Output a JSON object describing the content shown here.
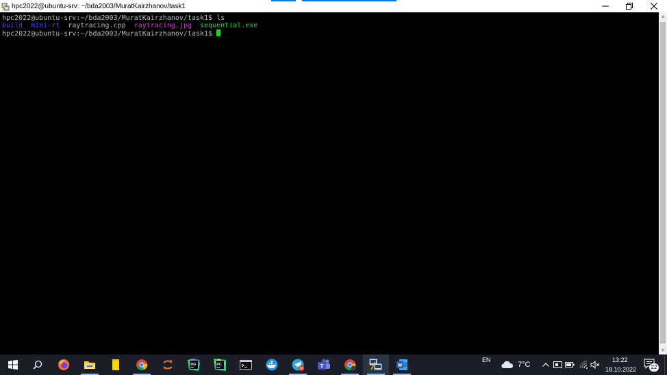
{
  "window": {
    "title": "hpc2022@ubuntu-srv: ~/bda2003/MuratKairzhanov/task1",
    "minimize_glyph": "—",
    "restore_glyph": "❐",
    "close_glyph": "✕"
  },
  "terminal": {
    "line1": {
      "prompt": "hpc2022@ubuntu-srv:~/bda2003/MuratKairzhanov/task1$",
      "command": " ls"
    },
    "ls_output": [
      {
        "name": "build",
        "color": "#3c50ff"
      },
      {
        "name": "mini-rt",
        "color": "#3c50ff"
      },
      {
        "name": "raytracing.cpp",
        "color": "#bbbbbb"
      },
      {
        "name": "raytracing.jpg",
        "color": "#d63cd6"
      },
      {
        "name": "sequential.exe",
        "color": "#2ed13b"
      }
    ],
    "line3": {
      "prompt": "hpc2022@ubuntu-srv:~/bda2003/MuratKairzhanov/task1$",
      "command": " "
    },
    "cursor_color": "#00e000"
  },
  "taskbar": {
    "apps": [
      {
        "name": "start",
        "icon": "windows-logo-icon"
      },
      {
        "name": "search",
        "icon": "search-icon"
      },
      {
        "name": "firefox",
        "icon": "firefox-icon"
      },
      {
        "name": "file-explorer",
        "icon": "folder-icon"
      },
      {
        "name": "sticky-notes",
        "icon": "sticky-notes-icon"
      },
      {
        "name": "chrome",
        "icon": "chrome-icon"
      },
      {
        "name": "jupyter",
        "icon": "jupyter-icon"
      },
      {
        "name": "datagrip",
        "icon": "datagrip-icon",
        "label": "DG"
      },
      {
        "name": "pycharm",
        "icon": "pycharm-icon",
        "label": "PC"
      },
      {
        "name": "terminal",
        "icon": "terminal-icon"
      },
      {
        "name": "docker",
        "icon": "docker-icon"
      },
      {
        "name": "telegram",
        "icon": "telegram-icon",
        "badge": "16"
      },
      {
        "name": "teams",
        "icon": "teams-icon"
      },
      {
        "name": "chrome-profile",
        "icon": "chrome-icon"
      },
      {
        "name": "putty",
        "icon": "putty-icon"
      },
      {
        "name": "word",
        "icon": "word-icon",
        "label": "W"
      }
    ],
    "language": "EN",
    "weather_temp": "7°C",
    "time": "13:22",
    "date": "18.10.2022",
    "notification_count": "22",
    "accent": "#0078d7"
  }
}
